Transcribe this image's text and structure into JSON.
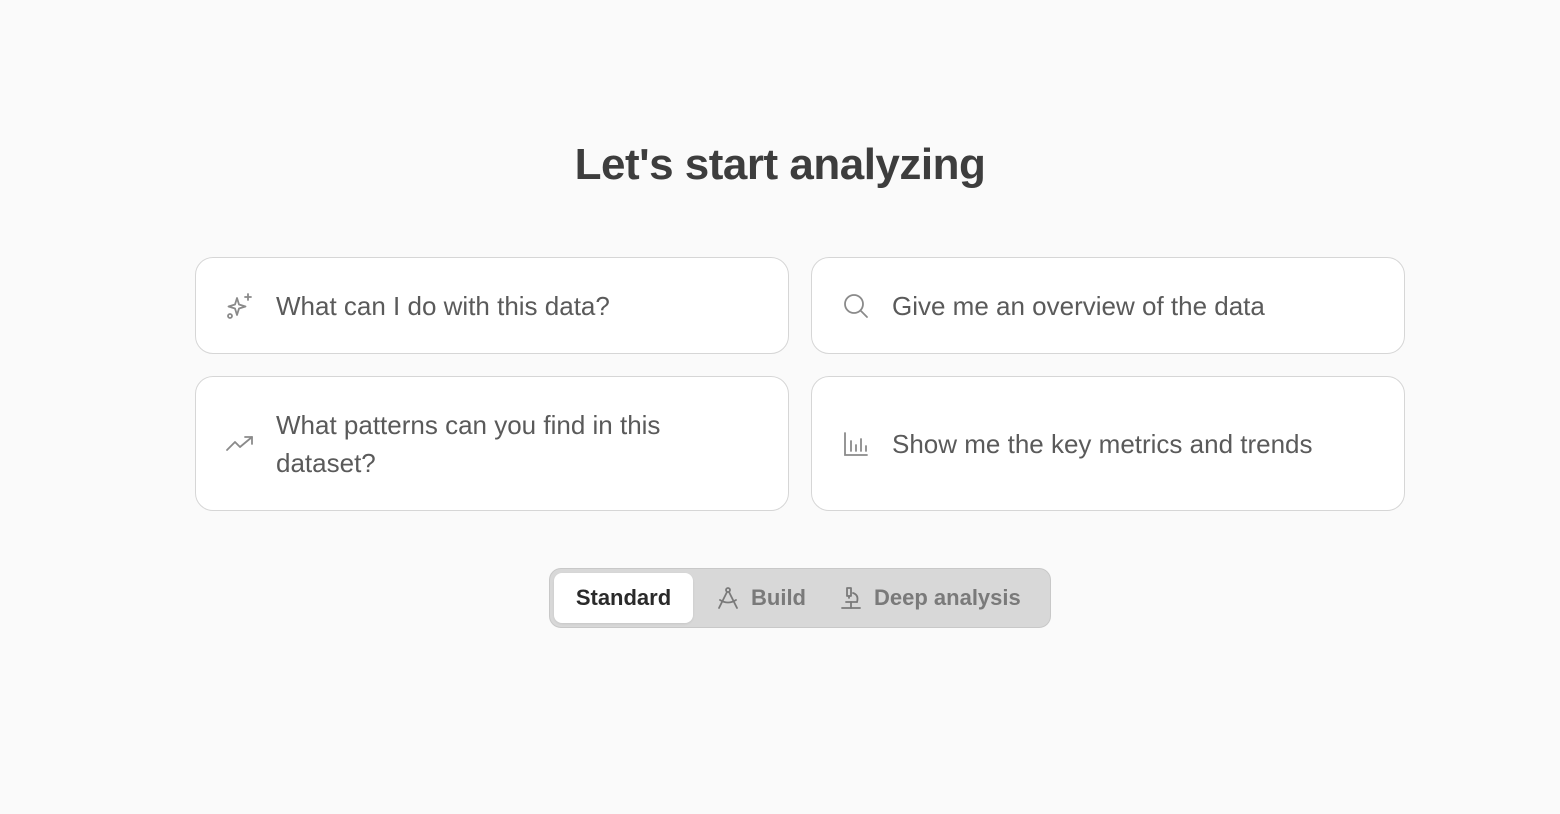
{
  "page": {
    "title": "Let's start analyzing"
  },
  "suggestions": [
    {
      "icon": "sparkles-icon",
      "text": "What can I do with this data?"
    },
    {
      "icon": "search-icon",
      "text": "Give me an overview of the data"
    },
    {
      "icon": "trending-up-icon",
      "text": "What patterns can you find in this dataset?"
    },
    {
      "icon": "bar-chart-icon",
      "text": "Show me the key metrics and trends"
    }
  ],
  "modes": {
    "selected": "Standard",
    "items": [
      {
        "label": "Standard",
        "icon": ""
      },
      {
        "label": "Build",
        "icon": "compass-icon"
      },
      {
        "label": "Deep analysis",
        "icon": "microscope-icon"
      }
    ]
  },
  "colors": {
    "background": "#fafafa",
    "card_border": "#d6d6d6",
    "toggle_background": "#d8d8d8",
    "active_mode_background": "#ffffff"
  }
}
